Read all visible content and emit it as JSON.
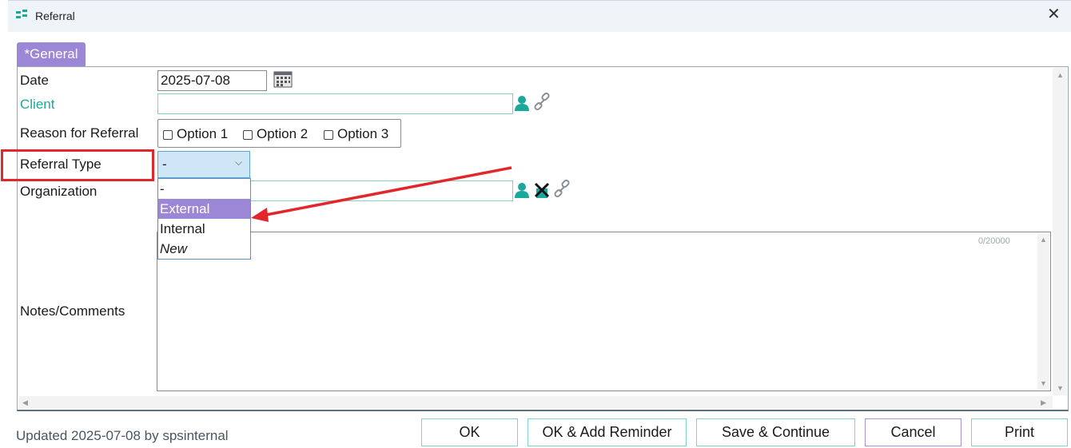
{
  "window": {
    "title": "Referral",
    "close_glyph": "✕",
    "icon": "referral-app-icon"
  },
  "tabs": [
    {
      "label": "*General",
      "active": true
    }
  ],
  "form": {
    "date": {
      "label": "Date",
      "value": "2025-07-08",
      "icon": "calendar-icon"
    },
    "client": {
      "label": "Client",
      "value": "",
      "icons": [
        "person-icon",
        "link-icon"
      ]
    },
    "reason": {
      "label": "Reason for Referral",
      "options": [
        "Option 1",
        "Option 2",
        "Option 3"
      ]
    },
    "referral_type": {
      "label": "Referral Type",
      "value": "-",
      "options": [
        "-",
        "External",
        "Internal",
        "New"
      ],
      "highlighted": "External"
    },
    "organization": {
      "label": "Organization",
      "value": "",
      "icons": [
        "person-icon",
        "remove-icon",
        "link-icon"
      ]
    },
    "notes": {
      "label": "Notes/Comments",
      "value": "",
      "counter": "0/20000"
    }
  },
  "footer": {
    "status": "Updated 2025-07-08 by spsinternal"
  },
  "buttons": {
    "ok": "OK",
    "ok_reminder": "OK & Add Reminder",
    "save_continue": "Save & Continue",
    "cancel": "Cancel",
    "print": "Print"
  },
  "colors": {
    "accent": "#9b87d6",
    "teal": "#1aa89a",
    "annotation_red": "#e3262b"
  }
}
